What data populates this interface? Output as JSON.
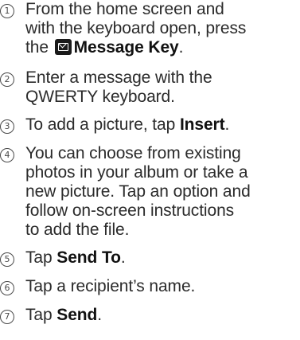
{
  "steps": [
    {
      "number": "1",
      "lines": [
        "From the home screen and",
        "with the keyboard open, press"
      ],
      "line3_pre": "the ",
      "line3_bold": "Message Key",
      "line3_post": ".",
      "icon": "message-key-icon"
    },
    {
      "number": "2",
      "lines": [
        "Enter a message with the",
        "QWERTY keyboard."
      ]
    },
    {
      "number": "3",
      "pre": "To add a picture, tap ",
      "bold": "Insert",
      "post": "."
    },
    {
      "number": "4",
      "lines": [
        "You can choose from existing",
        "photos in your album or take a",
        "new picture. Tap an option and",
        "follow on-screen instructions",
        "to add the file."
      ]
    },
    {
      "number": "5",
      "pre": "Tap ",
      "bold": "Send To",
      "post": "."
    },
    {
      "number": "6",
      "text": "Tap a recipient’s name."
    },
    {
      "number": "7",
      "pre": "Tap ",
      "bold": "Send",
      "post": "."
    }
  ]
}
